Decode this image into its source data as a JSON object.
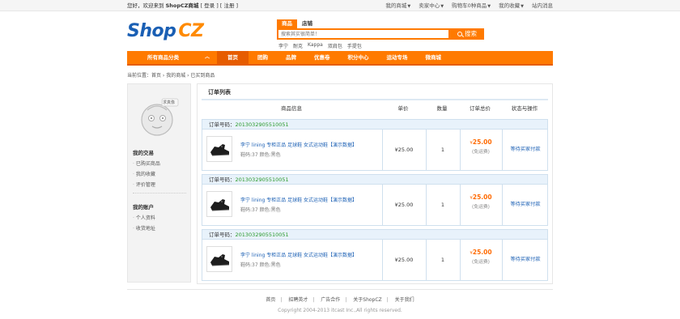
{
  "topbar": {
    "greeting_prefix": "您好，欢迎来到",
    "site": "ShopCZ商城",
    "login_link": "[ 登录 ]",
    "register_link": "[ 注册 ]",
    "menu": [
      "我的商城",
      "卖家中心",
      "购物车0种商品",
      "我的收藏",
      "站内消息"
    ]
  },
  "logo": {
    "part1": "Shop",
    "part2": "CZ"
  },
  "search": {
    "tab_active": "商品",
    "tab_other": "店铺",
    "placeholder": "搜索其实很简单！",
    "button": "搜索",
    "hot_words": [
      "李宁",
      "耐克",
      "Kappa",
      "双肩包",
      "手提包"
    ]
  },
  "nav": {
    "all_label": "所有商品分类",
    "items": [
      "首页",
      "团购",
      "品牌",
      "优惠卷",
      "积分中心",
      "运动专场",
      "微商城"
    ]
  },
  "breadcrumb": "当前位置：首页 › 我的商城 › 已买到商品",
  "sidebar": {
    "avatar_tag": "求真像",
    "group1_title": "我的交易",
    "group1_links": [
      "已购买商品",
      "我的收藏",
      "评价管理"
    ],
    "group2_title": "我的账户",
    "group2_links": [
      "个人资料",
      "收货地址"
    ]
  },
  "orders_panel": {
    "title": "订单列表",
    "columns": [
      "商品信息",
      "单价",
      "数量",
      "订单总价",
      "状态与操作"
    ],
    "orders": [
      {
        "order_label": "订单号码：",
        "order_no": "2013032905510051",
        "product_name": "李宁 lining 专柜正品 足球鞋 女式运动鞋【演示数据】",
        "product_attrs": "鞋码:37 颜色:黑色",
        "unit_price": "¥25.00",
        "quantity": "1",
        "currency": "¥",
        "total": "25.00",
        "shipping": "(免运费)",
        "status": "等待买家付款"
      },
      {
        "order_label": "订单号码：",
        "order_no": "2013032905510051",
        "product_name": "李宁 lining 专柜正品 足球鞋 女式运动鞋【演示数据】",
        "product_attrs": "鞋码:37 颜色:黑色",
        "unit_price": "¥25.00",
        "quantity": "1",
        "currency": "¥",
        "total": "25.00",
        "shipping": "(免运费)",
        "status": "等待买家付款"
      },
      {
        "order_label": "订单号码：",
        "order_no": "2013032905510051",
        "product_name": "李宁 lining 专柜正品 足球鞋 女式运动鞋【演示数据】",
        "product_attrs": "鞋码:37 颜色:黑色",
        "unit_price": "¥25.00",
        "quantity": "1",
        "currency": "¥",
        "total": "25.00",
        "shipping": "(免运费)",
        "status": "等待买家付款"
      }
    ]
  },
  "footer": {
    "links": [
      "首页",
      "招聘英才",
      "广告合作",
      "关于ShopCZ",
      "关于我们"
    ],
    "copyright": "Copyright 2004-2013 itcast Inc.,All rights reserved."
  },
  "colors": {
    "accent": "#ff7a00",
    "link": "#1a5fb4",
    "order_no": "#2b9a2b"
  }
}
